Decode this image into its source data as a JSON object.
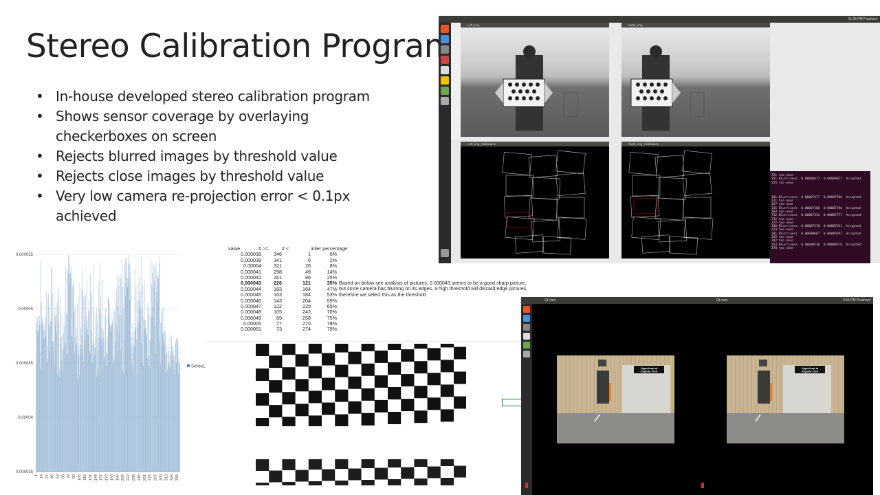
{
  "slide": {
    "title": "Stereo Calibration Program",
    "bullets": [
      "In-house developed stereo calibration program",
      "Shows sensor coverage by overlaying checkerboxes on screen",
      "Rejects blurred images by threshold value",
      "Rejects close images by threshold value",
      "Very low camera re-projection error < 0.1px achieved"
    ]
  },
  "calib_window": {
    "top_bar_right": "11:36 PM  Prashant",
    "left_title": "Left_img",
    "right_title": "Right_img",
    "left_calib_title": "Left_img_Calibration",
    "right_calib_title": "Right_img_Calibration",
    "terminal_lines": [
      "721 too near",
      "351 Blurriness  0.00008471  0.00009027  Accepted",
      "355 too near",
      "",
      "",
      "",
      "101 Blurriness  0.00007477  0.00007780  Accepted",
      "121 too near",
      "127 too near",
      "135 Blurriness  0.00007366  0.00007786  Accepted",
      "193 too near",
      "732 Blurriness  0.00007334  0.00007777  Accepted",
      "732 too near",
      "172 too near",
      "336 Blurriness  0.00007370  0.00007631  Accepted",
      "324 too near",
      "341 Blurriness  0.00008887  0.00009291  Accepted",
      "355 too near",
      "342 too near",
      "353 Blurriness  0.00008536  0.00009178  Accepted",
      "370 too near"
    ]
  },
  "qcam_window": {
    "title_left": "Qt-cam",
    "title_right": "Qt-cam",
    "top_bar_right": "4:55 PM  Prashant",
    "sign_text_line1": "Hyperloop at",
    "sign_text_line2": "Virginia Tech"
  },
  "threshold_table": {
    "headers": [
      "value",
      "# >=",
      "# <",
      "inlier percentage"
    ],
    "rows": [
      [
        "0.000038",
        "346",
        "1",
        "0%"
      ],
      [
        "0.000039",
        "341",
        "6",
        "2%"
      ],
      [
        "0.00004",
        "321",
        "26",
        "8%"
      ],
      [
        "0.000041",
        "298",
        "49",
        "14%"
      ],
      [
        "0.000042",
        "261",
        "86",
        "25%"
      ],
      [
        "0.000043",
        "226",
        "121",
        "35%"
      ],
      [
        "0.000044",
        "183",
        "164",
        "47%"
      ],
      [
        "0.000045",
        "163",
        "184",
        "53%"
      ],
      [
        "0.000046",
        "143",
        "204",
        "59%"
      ],
      [
        "0.000047",
        "122",
        "225",
        "65%"
      ],
      [
        "0.000048",
        "105",
        "242",
        "70%"
      ],
      [
        "0.000049",
        "89",
        "258",
        "75%"
      ],
      [
        "0.00005",
        "77",
        "270",
        "78%"
      ],
      [
        "0.000051",
        "73",
        "274",
        "79%"
      ]
    ],
    "bold_row_index": 5,
    "notes": [
      "Based on below see analysis of pictures, 0.000043 seems to be a good sharp picture,",
      "but since camera has blurring on its edges, a high threshold will discard edge pictures,",
      "therefore we select this as the threshold"
    ]
  },
  "chart_data": {
    "type": "bar",
    "series": [
      {
        "name": "Series1"
      }
    ],
    "y_ticks": [
      "0.000055",
      "0.00005",
      "0.000045",
      "0.00004",
      "0.000035"
    ],
    "ylim": [
      3.5e-05,
      5.5e-05
    ],
    "x_ticks": [
      "1",
      "14",
      "27",
      "40",
      "53",
      "66",
      "79",
      "92",
      "105",
      "118",
      "131",
      "144",
      "157",
      "170",
      "183",
      "196",
      "209",
      "222",
      "235",
      "248",
      "261",
      "274",
      "287",
      "300",
      "313",
      "326",
      "339"
    ],
    "bar_count": 346,
    "bar_color": "#9dbad6",
    "grid": true,
    "legend": "right"
  },
  "colors": {
    "terminal_bg": "#2f0a24",
    "ubuntu_bar": "#3c3b37",
    "bar_fill": "#9dbad6"
  }
}
